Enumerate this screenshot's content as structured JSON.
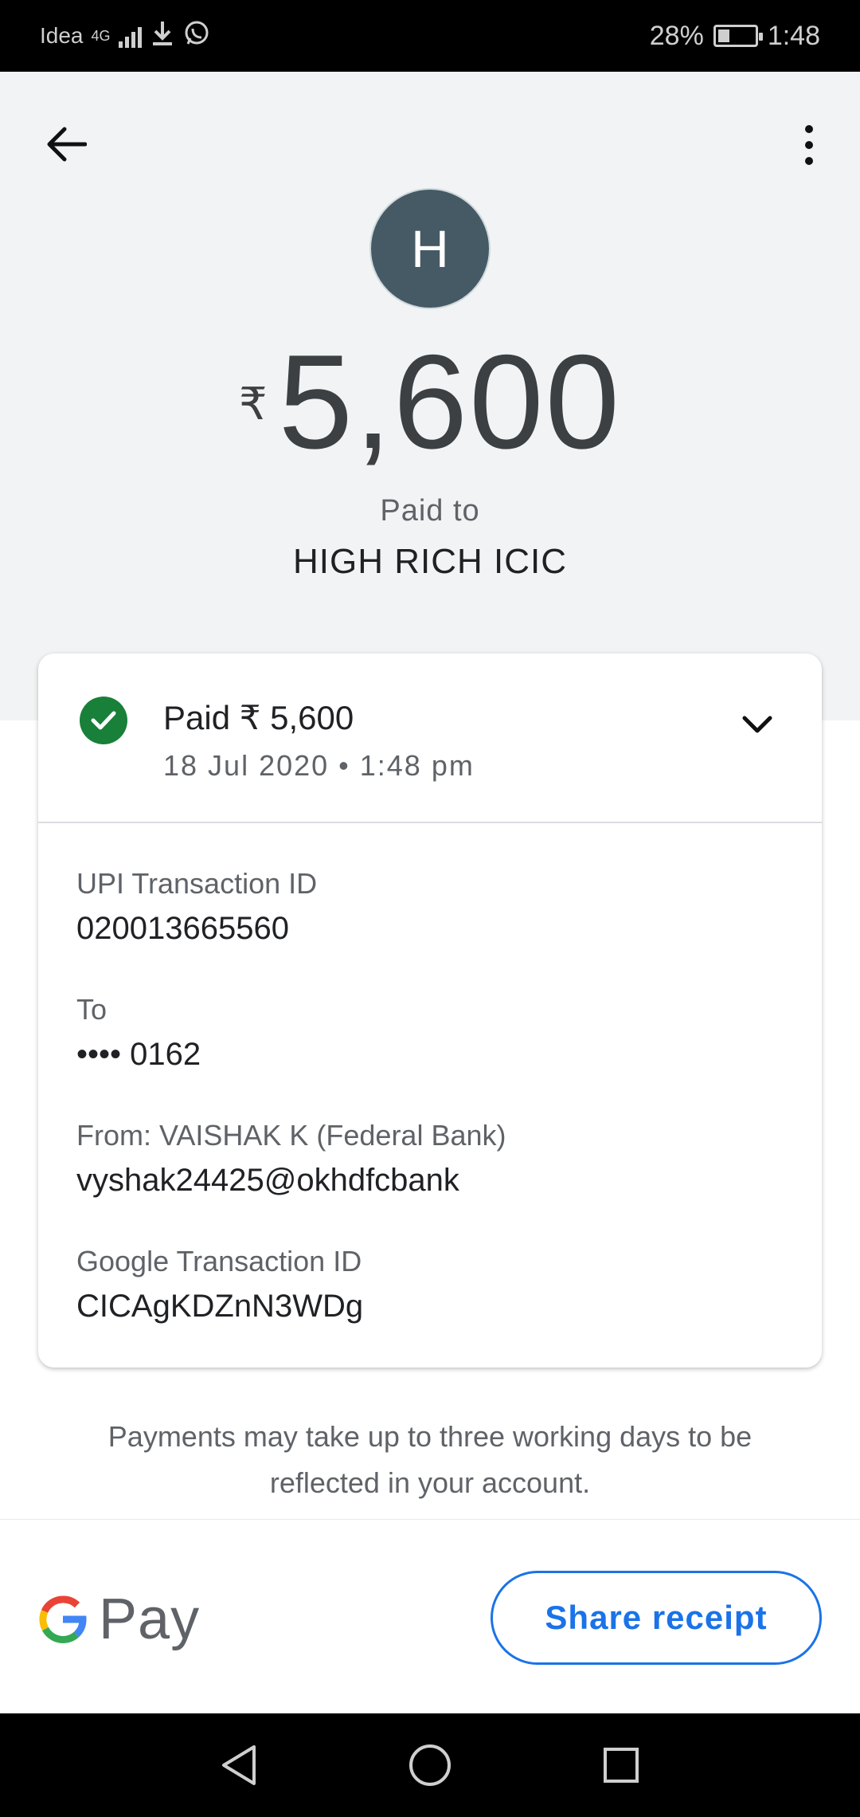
{
  "status_bar": {
    "carrier": "Idea",
    "network": "4G",
    "battery": "28%",
    "time": "1:48"
  },
  "header": {
    "back_icon": "arrow-left-icon",
    "menu_icon": "more-vert-icon",
    "avatar_letter": "H",
    "currency_symbol": "₹",
    "amount": "5,600",
    "paid_to_label": "Paid to",
    "payee_name": "HIGH RICH ICIC"
  },
  "card": {
    "status_title": "Paid ₹ 5,600",
    "status_date": "18 Jul 2020 • 1:48 pm",
    "status_color": "#188038",
    "details": [
      {
        "label": "UPI Transaction ID",
        "value": "020013665560"
      },
      {
        "label": "To",
        "value": "•••• 0162"
      },
      {
        "label": "From: VAISHAK K (Federal Bank)",
        "value": "vyshak24425@okhdfcbank"
      },
      {
        "label": "Google Transaction ID",
        "value": "CICAgKDZnN3WDg"
      }
    ]
  },
  "notice": "Payments may take up to three working days to be reflected in your account.",
  "bottom": {
    "brand": "Pay",
    "share_label": "Share receipt",
    "accent": "#1a73e8"
  },
  "nav": {
    "back": "triangle-back-icon",
    "home": "circle-home-icon",
    "recents": "square-recents-icon"
  }
}
